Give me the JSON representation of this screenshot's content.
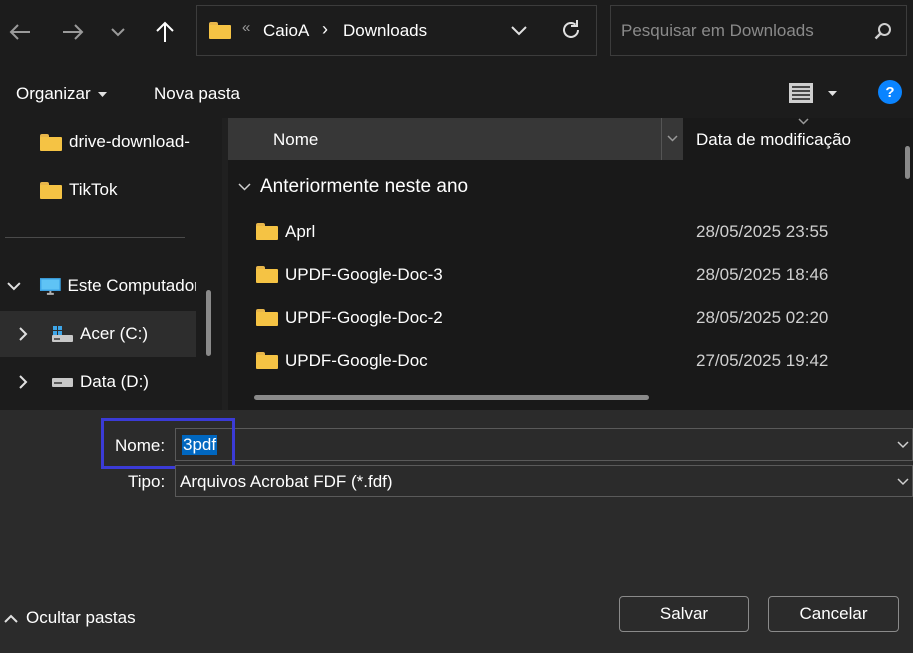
{
  "toolbar": {
    "back_icon": "arrow-left-icon",
    "forward_icon": "arrow-right-icon",
    "recent_icon": "chevron-down-icon",
    "up_icon": "arrow-up-icon",
    "refresh_icon": "refresh-icon"
  },
  "address": {
    "overflow": "«",
    "crumbs": [
      "CaioA",
      "Downloads"
    ],
    "separator": "›"
  },
  "search": {
    "placeholder": "Pesquisar em Downloads"
  },
  "commandbar": {
    "organize_label": "Organizar",
    "new_folder_label": "Nova pasta",
    "help_label": "?"
  },
  "nav": {
    "items": [
      {
        "label": "drive-download-"
      },
      {
        "label": "TikTok"
      },
      {
        "label": "Este Computador"
      },
      {
        "label": "Acer (C:)"
      },
      {
        "label": "Data (D:)"
      }
    ]
  },
  "filelist": {
    "col_name": "Nome",
    "col_date": "Data de modificação",
    "group_label": "Anteriormente neste ano",
    "rows": [
      {
        "name": "Aprl",
        "date": "28/05/2025 23:55"
      },
      {
        "name": "UPDF-Google-Doc-3",
        "date": "28/05/2025 18:46"
      },
      {
        "name": "UPDF-Google-Doc-2",
        "date": "28/05/2025 02:20"
      },
      {
        "name": "UPDF-Google-Doc",
        "date": "27/05/2025 19:42"
      }
    ]
  },
  "form": {
    "name_label": "Nome:",
    "name_value": "3pdf",
    "type_label": "Tipo:",
    "type_value": "Arquivos Acrobat FDF (*.fdf)"
  },
  "footer": {
    "hide_folders_label": "Ocultar pastas",
    "save_label": "Salvar",
    "cancel_label": "Cancelar"
  },
  "colors": {
    "accent": "#0067c0",
    "highlight_box": "#3b3bd6",
    "folder": "#f5c344"
  }
}
